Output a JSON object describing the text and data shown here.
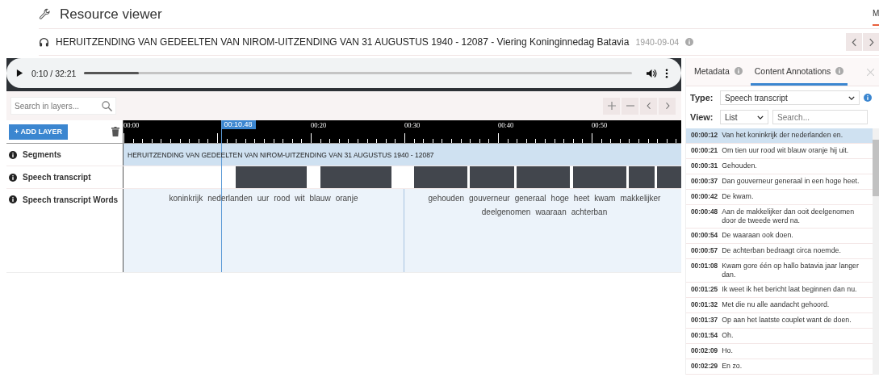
{
  "header": {
    "title": "Resource viewer",
    "corner_tab": "M"
  },
  "resource": {
    "title": "HERUITZENDING VAN GEDEELTEN VAN NIROM-UITZENDING VAN 31 AUGUSTUS 1940 - 12087 - Viering Koninginnedag Batavia",
    "date": "1940-09-04"
  },
  "player": {
    "time": "0:10 / 32:21",
    "level": 0.1
  },
  "layers_toolbar": {
    "search_placeholder": "Search in layers...",
    "add_layer": "+ ADD LAYER"
  },
  "ruler": {
    "labels": [
      "00:00",
      "00:20",
      "00:30",
      "00:40",
      "00:50"
    ],
    "playhead": "00:10.48"
  },
  "layers": [
    {
      "kind": "segments",
      "name": "Segments",
      "text": "HERUITZENDING VAN GEDEELTEN VAN NIROM-UITZENDING VAN 31 AUGUSTUS 1940 - 12087"
    },
    {
      "kind": "blocks",
      "name": "Speech transcript"
    },
    {
      "kind": "words",
      "name": "Speech transcript Words",
      "groups": [
        {
          "lines": [
            [
              "koninkrijk",
              "nederlanden",
              "uur",
              "rood",
              "wit",
              "blauw",
              "oranje"
            ]
          ]
        },
        {
          "lines": [
            [
              "gehouden",
              "gouverneur",
              "generaal",
              "hoge",
              "heet",
              "kwam",
              "makkelijker"
            ],
            [
              "deelgenomen",
              "waaraan",
              "achterban"
            ]
          ]
        }
      ]
    }
  ],
  "panel": {
    "tabs": [
      {
        "label": "Metadata",
        "selected": false
      },
      {
        "label": "Content Annotations",
        "selected": true
      }
    ],
    "type_label": "Type:",
    "type_value": "Speech transcript",
    "view_label": "View:",
    "view_value": "List",
    "search_placeholder": "Search...",
    "annotations": [
      {
        "time": "00:00:12",
        "text": "Van het koninkrijk der nederlanden en.",
        "selected": true
      },
      {
        "time": "00:00:21",
        "text": "Om tien uur rood wit blauw oranje hij uit.",
        "selected": false
      },
      {
        "time": "00:00:31",
        "text": "Gehouden.",
        "selected": false
      },
      {
        "time": "00:00:37",
        "text": "Dan gouverneur generaal in een hoge heet.",
        "selected": false
      },
      {
        "time": "00:00:42",
        "text": "De kwam.",
        "selected": false
      },
      {
        "time": "00:00:48",
        "text": "Aan de makkelijker dan ooit deelgenomen door de tweede werd na.",
        "selected": false
      },
      {
        "time": "00:00:54",
        "text": "De waaraan ook doen.",
        "selected": false
      },
      {
        "time": "00:00:57",
        "text": "De achterban bedraagt circa noemde.",
        "selected": false
      },
      {
        "time": "00:01:08",
        "text": "Kwam gore één op hallo batavia jaar langer dan.",
        "selected": false
      },
      {
        "time": "00:01:25",
        "text": "Ik weet ik het bericht laat beginnen dan nu.",
        "selected": false
      },
      {
        "time": "00:01:32",
        "text": "Met die nu alle aandacht gehoord.",
        "selected": false
      },
      {
        "time": "00:01:37",
        "text": "Op aan het laatste couplet want de doen.",
        "selected": false
      },
      {
        "time": "00:01:54",
        "text": "Oh.",
        "selected": false
      },
      {
        "time": "00:02:09",
        "text": "Ho.",
        "selected": false
      },
      {
        "time": "00:02:29",
        "text": "En zo.",
        "selected": false
      }
    ]
  }
}
